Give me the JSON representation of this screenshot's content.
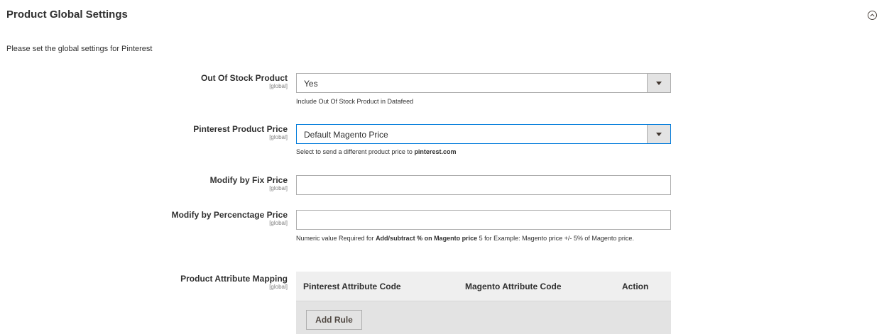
{
  "section": {
    "title": "Product Global Settings",
    "description": "Please set the global settings for Pinterest"
  },
  "fields": {
    "out_of_stock": {
      "label": "Out Of Stock Product",
      "scope": "[global]",
      "value": "Yes",
      "note": "Include Out Of Stock Product in Datafeed"
    },
    "product_price": {
      "label": "Pinterest Product Price",
      "scope": "[global]",
      "value": "Default Magento Price",
      "note_prefix": "Select to send a different product price to ",
      "note_bold": "pinterest.com"
    },
    "fix_price": {
      "label": "Modify by Fix Price",
      "scope": "[global]",
      "value": ""
    },
    "percentage_price": {
      "label": "Modify by Percenctage Price",
      "scope": "[global]",
      "value": "",
      "note_prefix": "Numeric value Required for ",
      "note_bold": "Add/subtract % on Magento price",
      "note_suffix": " 5 for Example: Magento price +/- 5% of Magento price."
    },
    "attribute_mapping": {
      "label": "Product Attribute Mapping",
      "scope": "[global]",
      "columns": [
        "Pinterest Attribute Code",
        "Magento Attribute Code",
        "Action"
      ],
      "add_button": "Add Rule"
    }
  },
  "colors": {
    "focus_border": "#007bdb",
    "grid_header_bg": "#efefef",
    "grid_footer_bg": "#e3e3e3"
  }
}
